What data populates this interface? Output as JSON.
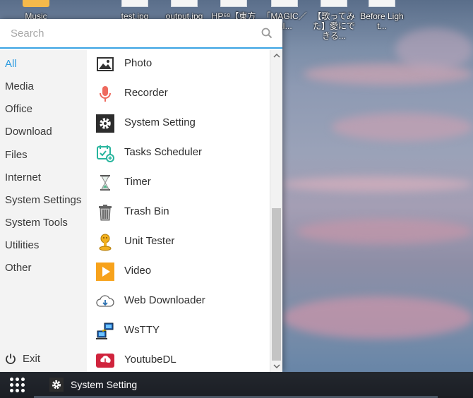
{
  "desktop": {
    "icons": [
      {
        "label": "Music"
      },
      {
        "label": "test.jpg"
      },
      {
        "label": "output.jpg"
      },
      {
        "label": "HP⁶⁸【東方V..."
      },
      {
        "label": "「MAGIC／\nAI..."
      },
      {
        "label": "【歌ってみた】愛にできる..."
      },
      {
        "label": "Before Light..."
      }
    ]
  },
  "menu": {
    "search": {
      "placeholder": "Search",
      "value": "",
      "icon": "search-icon"
    },
    "categories": [
      {
        "label": "All",
        "active": true
      },
      {
        "label": "Media"
      },
      {
        "label": "Office"
      },
      {
        "label": "Download"
      },
      {
        "label": "Files"
      },
      {
        "label": "Internet"
      },
      {
        "label": "System Settings"
      },
      {
        "label": "System Tools"
      },
      {
        "label": "Utilities"
      },
      {
        "label": "Other"
      }
    ],
    "exit": {
      "label": "Exit",
      "icon": "power-icon"
    },
    "apps": [
      {
        "name": "Photo",
        "icon": "photo-icon"
      },
      {
        "name": "Recorder",
        "icon": "microphone-icon"
      },
      {
        "name": "System Setting",
        "icon": "gear-icon"
      },
      {
        "name": "Tasks Scheduler",
        "icon": "calendar-icon"
      },
      {
        "name": "Timer",
        "icon": "hourglass-icon"
      },
      {
        "name": "Trash Bin",
        "icon": "trash-icon"
      },
      {
        "name": "Unit Tester",
        "icon": "unit-tester-icon"
      },
      {
        "name": "Video",
        "icon": "play-icon"
      },
      {
        "name": "Web Downloader",
        "icon": "cloud-download-icon"
      },
      {
        "name": "WsTTY",
        "icon": "network-terminal-icon"
      },
      {
        "name": "YoutubeDL",
        "icon": "youtube-download-icon"
      }
    ]
  },
  "taskbar": {
    "launcher_icon": "app-grid-icon",
    "active_task": {
      "label": "System Setting",
      "icon": "gear-icon"
    }
  },
  "colors": {
    "accent": "#2c9be0",
    "taskbar": "#1f2329"
  }
}
